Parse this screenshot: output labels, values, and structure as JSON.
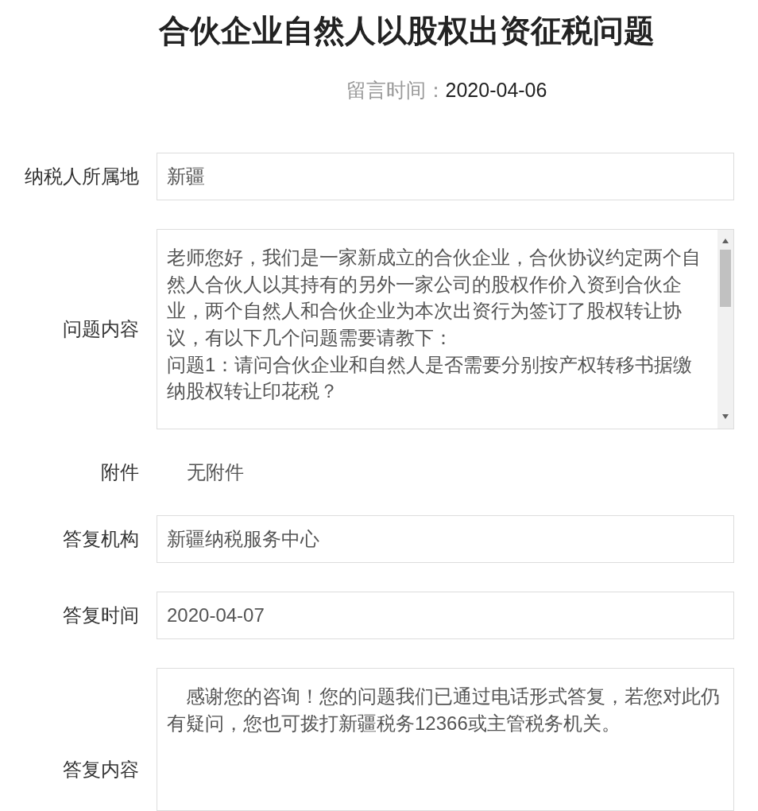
{
  "title": "合伙企业自然人以股权出资征税问题",
  "message_time": {
    "label": "留言时间：",
    "value": "2020-04-06"
  },
  "fields": [
    {
      "kind": "input",
      "label": "纳税人所属地",
      "value": "新疆"
    },
    {
      "kind": "scrollarea",
      "label": "问题内容",
      "paragraphs": [
        "老师您好，我们是一家新成立的合伙企业，合伙协议约定两个自然人合伙人以其持有的另外一家公司的股权作价入资到合伙企业，两个自然人和合伙企业为本次出资行为签订了股权转让协议，有以下几个问题需要请教下：",
        "问题1：请问合伙企业和自然人是否需要分别按产权转移书据缴纳股权转让印花税？"
      ]
    },
    {
      "kind": "plain",
      "label": "附件",
      "value": "无附件"
    },
    {
      "kind": "input",
      "label": "答复机构",
      "value": "新疆纳税服务中心"
    },
    {
      "kind": "input",
      "label": "答复时间",
      "value": "2020-04-07"
    },
    {
      "kind": "area",
      "label": "答复内容",
      "paragraphs": [
        "感谢您的咨询！您的问题我们已通过电话形式答复，若您对此仍有疑问，您也可拨打新疆税务12366或主管税务机关。"
      ]
    }
  ]
}
